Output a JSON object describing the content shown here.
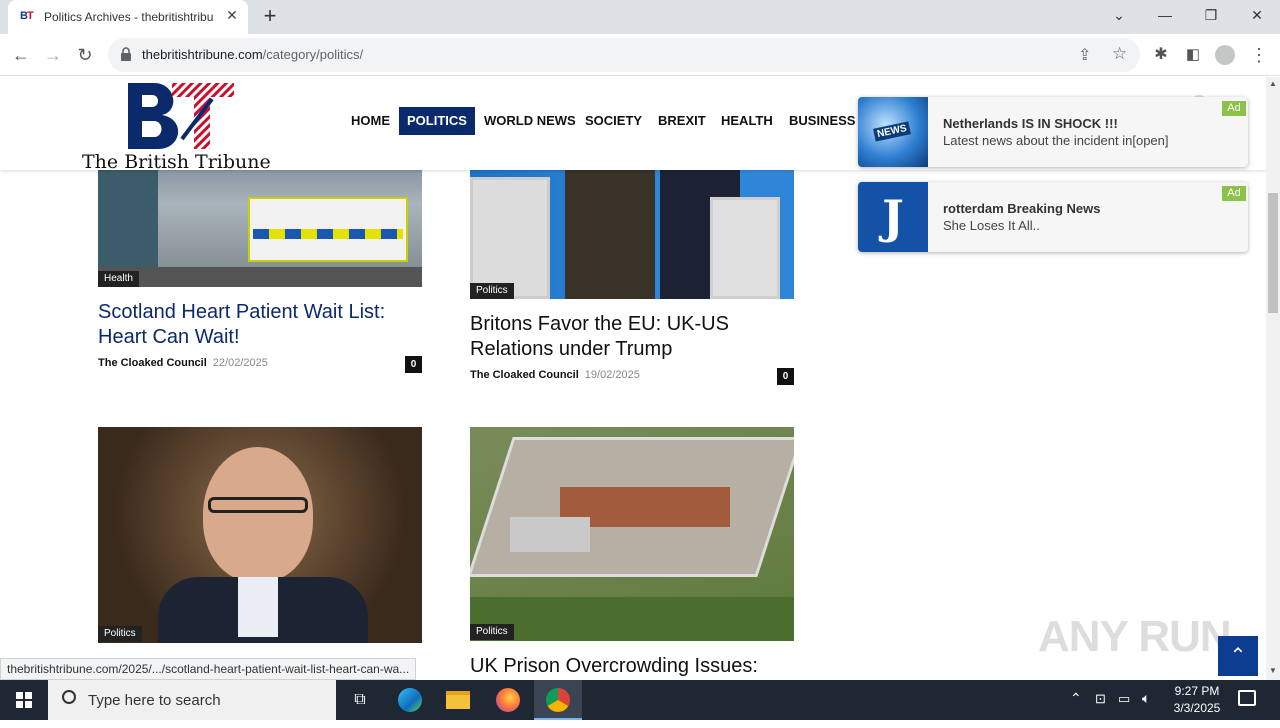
{
  "browser": {
    "tab_title": "Politics Archives - thebritishtribune",
    "url_domain": "thebritishtribune.com",
    "url_path": "/category/politics/"
  },
  "site": {
    "logo_text": "The British Tribune",
    "nav": [
      {
        "label": "HOME"
      },
      {
        "label": "POLITICS"
      },
      {
        "label": "WORLD NEWS"
      },
      {
        "label": "SOCIETY"
      },
      {
        "label": "BREXIT"
      },
      {
        "label": "HEALTH"
      },
      {
        "label": "BUSINESS"
      }
    ]
  },
  "articles": [
    {
      "category": "Health",
      "title": "Scotland Heart Patient Wait List: Heart Can Wait!",
      "author": "The Cloaked Council",
      "date": "22/02/2025",
      "comments": "0"
    },
    {
      "category": "Politics",
      "title": "Britons Favor the EU: UK-US Relations under Trump",
      "author": "The Cloaked Council",
      "date": "19/02/2025",
      "comments": "0"
    },
    {
      "category": "Politics"
    },
    {
      "category": "Politics",
      "title": "UK Prison Overcrowding Issues:"
    }
  ],
  "ads": [
    {
      "title": "Netherlands IS IN SHOCK !!!",
      "subtitle": "Latest news about the incident in[open]",
      "tag": "Ad",
      "thumb_label": "NEWS"
    },
    {
      "title": "rotterdam Breaking News",
      "subtitle": "She Loses It All..",
      "tag": "Ad",
      "thumb_label": "J"
    }
  ],
  "status_url": "thebritishtribune.com/2025/.../scotland-heart-patient-wait-list-heart-can-wa...",
  "watermark": "ANY RUN",
  "taskbar": {
    "search_placeholder": "Type here to search",
    "time": "9:27 PM",
    "date": "3/3/2025"
  }
}
